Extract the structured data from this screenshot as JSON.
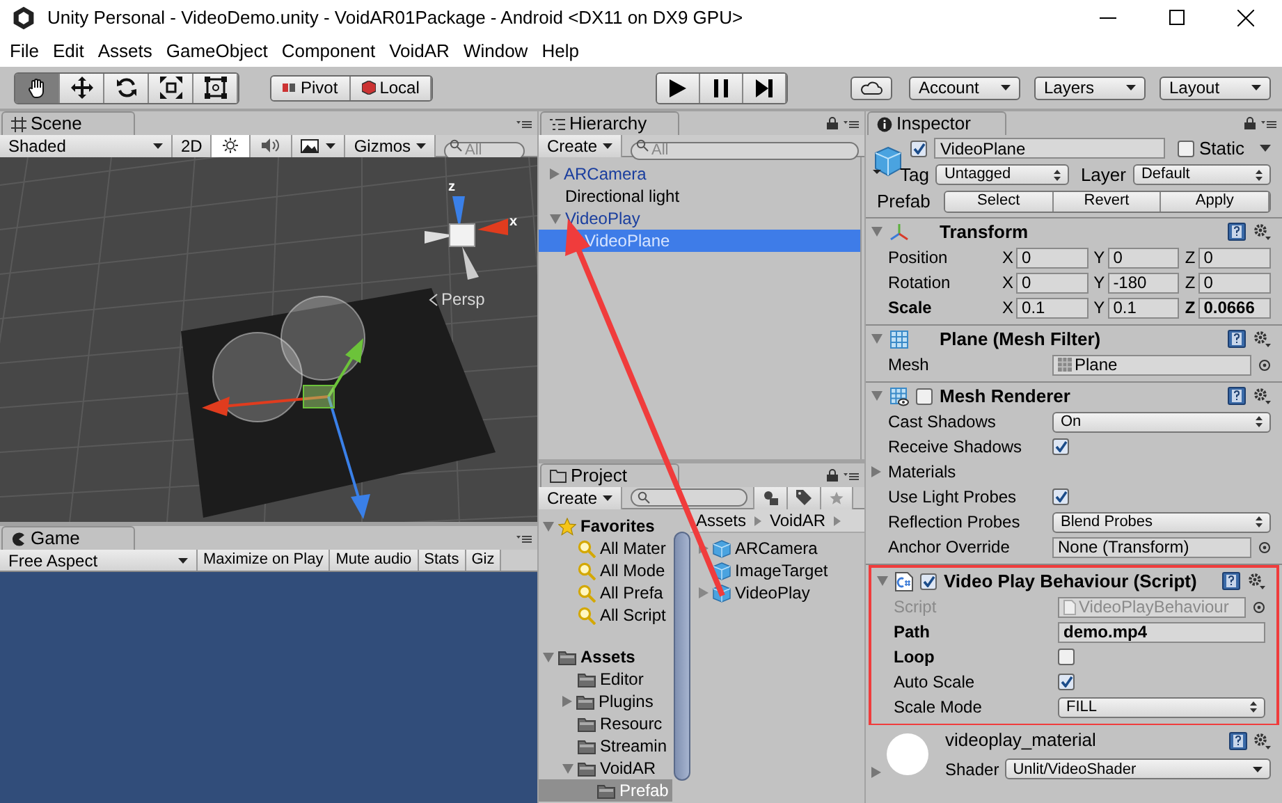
{
  "window": {
    "title": "Unity Personal - VideoDemo.unity - VoidAR01Package - Android <DX11 on DX9 GPU>"
  },
  "menu": [
    "File",
    "Edit",
    "Assets",
    "GameObject",
    "Component",
    "VoidAR",
    "Window",
    "Help"
  ],
  "toolbar": {
    "tools": [
      {
        "kind": "hand",
        "selected": true
      },
      {
        "kind": "move",
        "selected": false
      },
      {
        "kind": "rotate",
        "selected": false
      },
      {
        "kind": "scale",
        "selected": false
      },
      {
        "kind": "rect",
        "selected": false
      }
    ],
    "pivot": [
      "Pivot",
      "Local"
    ],
    "playback": [
      {
        "kind": "play"
      },
      {
        "kind": "pause"
      },
      {
        "kind": "step"
      }
    ],
    "account": "Account",
    "layers": "Layers",
    "layout": "Layout"
  },
  "scene": {
    "tab": "Scene",
    "shading": "Shaded",
    "mode_2d": "2D",
    "lighting": true,
    "audio": false,
    "gizmos": "Gizmos",
    "search_placeholder": "All",
    "view_label": "Persp",
    "axes": [
      "z",
      "x"
    ]
  },
  "game": {
    "tab": "Game",
    "aspect": "Free Aspect",
    "buttons": [
      "Maximize on Play",
      "Mute audio",
      "Stats",
      "Giz"
    ]
  },
  "hierarchy": {
    "tab": "Hierarchy",
    "create": "Create",
    "search_placeholder": "All",
    "items": [
      {
        "label": "ARCamera",
        "prefab": true,
        "expanded": false,
        "selected": false
      },
      {
        "label": "Directional light",
        "prefab": false,
        "selected": false
      },
      {
        "label": "VideoPlay",
        "prefab": true,
        "expanded": true,
        "selected": false,
        "children": [
          {
            "label": "VideoPlane",
            "prefab": true,
            "selected": true
          }
        ]
      }
    ]
  },
  "project": {
    "tab": "Project",
    "create": "Create",
    "folders": [
      {
        "label": "Favorites",
        "kind": "favorites",
        "expanded": true,
        "selected": false,
        "children": [
          {
            "label": "All Mater",
            "kind": "search",
            "selected": false
          },
          {
            "label": "All Mode",
            "kind": "search",
            "selected": false
          },
          {
            "label": "All Prefa",
            "kind": "search",
            "selected": false
          },
          {
            "label": "All Script",
            "kind": "search",
            "selected": false
          }
        ]
      },
      {
        "label": "Assets",
        "kind": "root",
        "expanded": true,
        "selected": false,
        "children": [
          {
            "label": "Editor",
            "kind": "folder",
            "selected": false
          },
          {
            "label": "Plugins",
            "kind": "folder",
            "expanded": false,
            "selected": false
          },
          {
            "label": "Resourc",
            "kind": "folder",
            "selected": false
          },
          {
            "label": "Streamin",
            "kind": "folder",
            "selected": false
          },
          {
            "label": "VoidAR",
            "kind": "folder",
            "expanded": true,
            "selected": false,
            "children": [
              {
                "label": "Prefab",
                "kind": "folder",
                "selected": true
              }
            ]
          }
        ]
      }
    ],
    "breadcrumb": [
      "Assets",
      "VoidAR"
    ],
    "assets": [
      {
        "label": "ARCamera",
        "expandable": true
      },
      {
        "label": "ImageTarget",
        "expandable": false
      },
      {
        "label": "VideoPlay",
        "expandable": true
      }
    ]
  },
  "inspector": {
    "tab": "Inspector",
    "object": {
      "name": "VideoPlane",
      "active": true,
      "static_label": "Static",
      "static": false,
      "tag_label": "Tag",
      "tag": "Untagged",
      "layer_label": "Layer",
      "layer": "Default",
      "prefab_label": "Prefab",
      "prefab_buttons": [
        "Select",
        "Revert",
        "Apply"
      ]
    },
    "components": [
      {
        "kind": "transform",
        "title": "Transform",
        "highlighted": false,
        "rows": [
          {
            "kind": "vector3",
            "label": "Position",
            "bold": false,
            "values": [
              {
                "axis": "X",
                "value": "0",
                "bold": false
              },
              {
                "axis": "Y",
                "value": "0",
                "bold": false
              },
              {
                "axis": "Z",
                "value": "0",
                "bold": false
              }
            ]
          },
          {
            "kind": "vector3",
            "label": "Rotation",
            "bold": false,
            "values": [
              {
                "axis": "X",
                "value": "0",
                "bold": false
              },
              {
                "axis": "Y",
                "value": "-180",
                "bold": false
              },
              {
                "axis": "Z",
                "value": "0",
                "bold": false
              }
            ]
          },
          {
            "kind": "vector3",
            "label": "Scale",
            "bold": true,
            "values": [
              {
                "axis": "X",
                "value": "0.1",
                "bold": false
              },
              {
                "axis": "Y",
                "value": "0.1",
                "bold": false
              },
              {
                "axis": "Z",
                "value": "0.0666",
                "bold": true
              }
            ]
          }
        ]
      },
      {
        "kind": "mesh_filter",
        "title": "Plane (Mesh Filter)",
        "highlighted": false,
        "rows": [
          {
            "kind": "object",
            "label": "Mesh",
            "value": "Plane",
            "bold": false,
            "disabled": false
          }
        ]
      },
      {
        "kind": "mesh_renderer",
        "title": "Mesh Renderer",
        "enabled": false,
        "highlighted": false,
        "rows": [
          {
            "kind": "dropdown",
            "label": "Cast Shadows",
            "value": "On",
            "bold": false
          },
          {
            "kind": "checkbox",
            "label": "Receive Shadows",
            "checked": true,
            "bold": false
          },
          {
            "kind": "foldout",
            "label": "Materials",
            "expanded": false
          },
          {
            "kind": "checkbox",
            "label": "Use Light Probes",
            "checked": true,
            "bold": false
          },
          {
            "kind": "dropdown",
            "label": "Reflection Probes",
            "value": "Blend Probes",
            "bold": false
          },
          {
            "kind": "object",
            "label": "Anchor Override",
            "value": "None (Transform)",
            "bold": false,
            "disabled": false
          }
        ]
      },
      {
        "kind": "script",
        "title": "Video Play Behaviour (Script)",
        "enabled": true,
        "highlighted": true,
        "rows": [
          {
            "kind": "object",
            "label": "Script",
            "value": "VideoPlayBehaviour",
            "bold": false,
            "disabled": true
          },
          {
            "kind": "text",
            "label": "Path",
            "value": "demo.mp4",
            "bold": true
          },
          {
            "kind": "checkbox",
            "label": "Loop",
            "checked": false,
            "bold": true
          },
          {
            "kind": "checkbox",
            "label": "Auto Scale",
            "checked": true,
            "bold": false
          },
          {
            "kind": "dropdown",
            "label": "Scale Mode",
            "value": "FILL",
            "bold": false
          }
        ]
      }
    ],
    "material": {
      "name": "videoplay_material",
      "shader_label": "Shader",
      "shader": "Unlit/VideoShader"
    }
  }
}
